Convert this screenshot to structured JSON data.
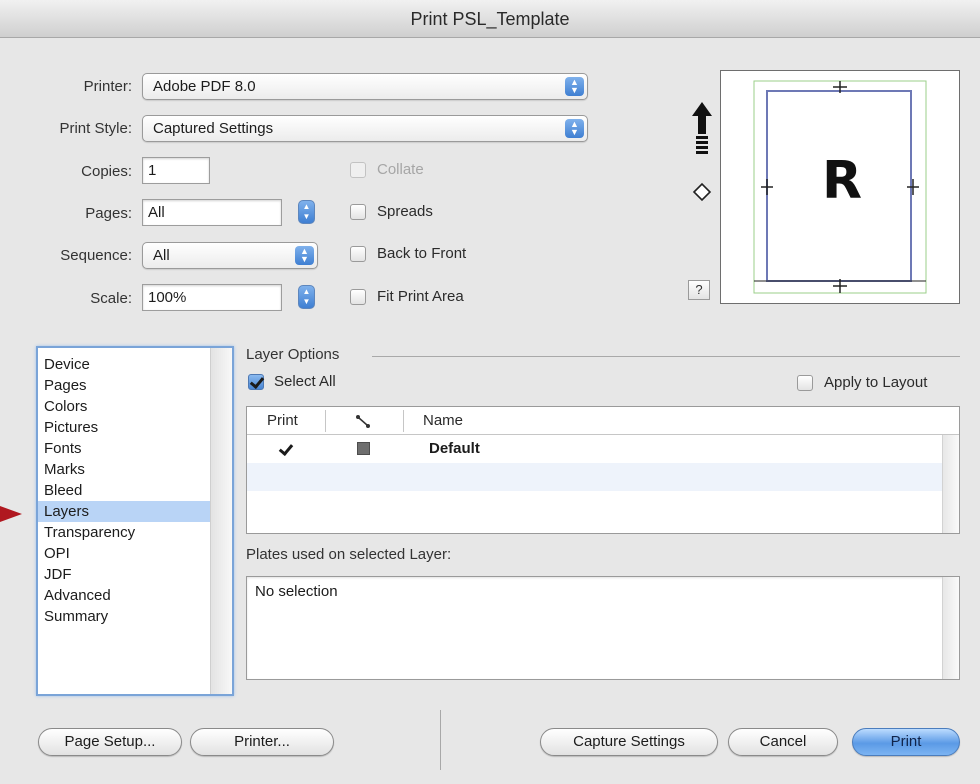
{
  "window": {
    "title": "Print PSL_Template"
  },
  "printer": {
    "label": "Printer:",
    "value": "Adobe PDF 8.0"
  },
  "print_style": {
    "label": "Print Style:",
    "value": "Captured Settings"
  },
  "copies": {
    "label": "Copies:",
    "value": "1"
  },
  "pages": {
    "label": "Pages:",
    "value": "All"
  },
  "sequence": {
    "label": "Sequence:",
    "value": "All"
  },
  "scale": {
    "label": "Scale:",
    "value": "100%"
  },
  "options": {
    "collate": {
      "label": "Collate",
      "checked": false,
      "enabled": false
    },
    "spreads": {
      "label": "Spreads",
      "checked": false
    },
    "back_to_front": {
      "label": "Back to Front",
      "checked": false
    },
    "fit_print_area": {
      "label": "Fit Print Area",
      "checked": false
    }
  },
  "preview": {
    "letter": "R",
    "help": "?"
  },
  "sidebar": {
    "items": [
      {
        "label": "Device"
      },
      {
        "label": "Pages"
      },
      {
        "label": "Colors"
      },
      {
        "label": "Pictures"
      },
      {
        "label": "Fonts"
      },
      {
        "label": "Marks"
      },
      {
        "label": "Bleed"
      },
      {
        "label": "Layers",
        "selected": true
      },
      {
        "label": "Transparency"
      },
      {
        "label": "OPI"
      },
      {
        "label": "JDF"
      },
      {
        "label": "Advanced"
      },
      {
        "label": "Summary"
      }
    ]
  },
  "layer_options": {
    "title": "Layer Options",
    "select_all": {
      "label": "Select All",
      "checked": true
    },
    "apply_to_layout": {
      "label": "Apply to Layout",
      "checked": false
    },
    "columns": {
      "print": "Print",
      "name": "Name"
    },
    "rows": [
      {
        "print": true,
        "name": "Default",
        "color": "#6e6e6e"
      }
    ]
  },
  "plates": {
    "label": "Plates used on selected Layer:",
    "value": "No selection"
  },
  "buttons": {
    "page_setup": "Page Setup...",
    "printer": "Printer...",
    "capture_settings": "Capture Settings",
    "cancel": "Cancel",
    "print": "Print"
  },
  "colors": {
    "selection": "#b9d4f6",
    "accent": "#5b9ae6",
    "pointer": "#b01820"
  }
}
